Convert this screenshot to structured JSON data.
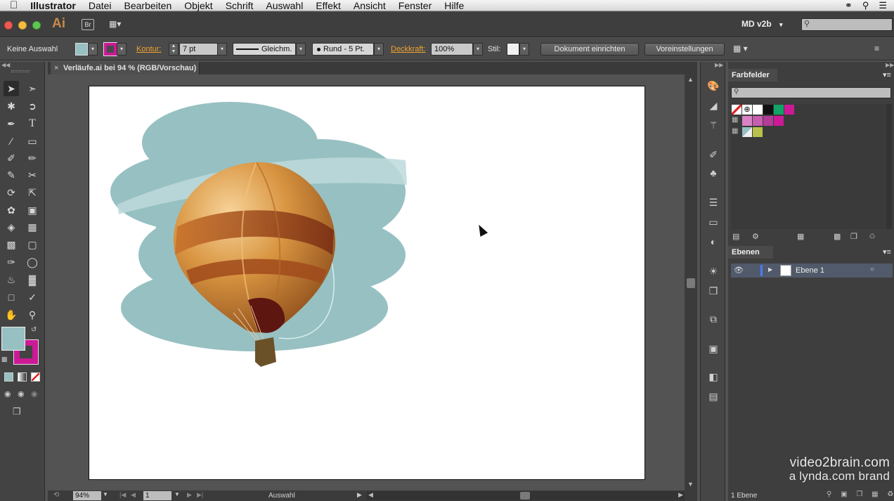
{
  "menubar": {
    "app_name": "Illustrator",
    "items": [
      "Datei",
      "Bearbeiten",
      "Objekt",
      "Schrift",
      "Auswahl",
      "Effekt",
      "Ansicht",
      "Fenster",
      "Hilfe"
    ]
  },
  "appbar": {
    "ai_logo": "Ai",
    "bridge_label": "Br",
    "workspace": "MD v2b",
    "workspace_arrow": "▾",
    "search_placeholder": ""
  },
  "controlbar": {
    "selection_label": "Keine Auswahl",
    "kontur_label": "Kontur:",
    "kontur_value": "7 pt",
    "stroke_profile": "Gleichm.",
    "brush_label": "Rund - 5 Pt.",
    "deckkraft_label": "Deckkraft:",
    "deckkraft_value": "100%",
    "stil_label": "Stil:",
    "dokument_button": "Dokument einrichten",
    "voreinstellungen_button": "Voreinstellungen"
  },
  "document": {
    "tab_title": "Verläufe.ai bei 94 % (RGB/Vorschau)",
    "close_symbol": "×"
  },
  "statusbar": {
    "zoom": "94%",
    "page": "1",
    "tool_status": "Auswahl"
  },
  "farbfelder": {
    "title": "Farbfelder",
    "search_placeholder": ""
  },
  "ebenen": {
    "title": "Ebenen",
    "layer_name": "Ebene 1",
    "footer": "1 Ebene"
  },
  "watermark": {
    "line1": "video2brain.com",
    "line2": "a lynda.com brand"
  },
  "colors": {
    "fill_color": "#97c0c2",
    "stroke_color": "#cc1a96",
    "cloud": "#97c0c2",
    "accent_orange": "#f0a330"
  }
}
